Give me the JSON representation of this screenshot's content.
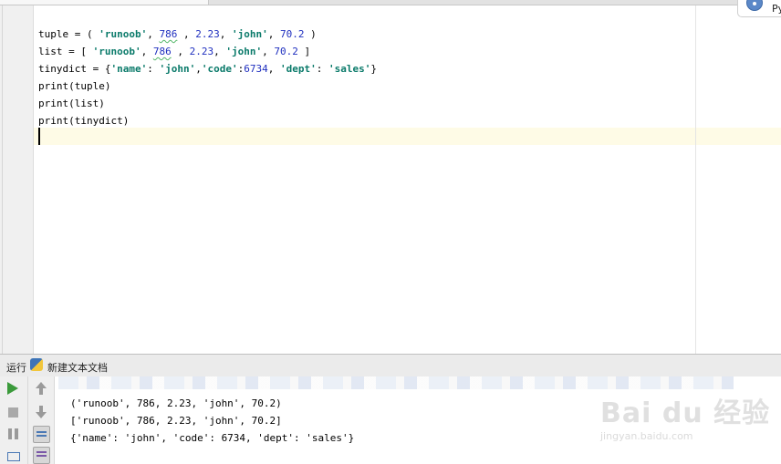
{
  "notification": {
    "text": "Py"
  },
  "editor": {
    "lines": [
      [
        {
          "t": "tuple = ( "
        },
        {
          "t": "'runoob'",
          "c": "str"
        },
        {
          "t": ", "
        },
        {
          "t": "786",
          "c": "num squig"
        },
        {
          "t": " , "
        },
        {
          "t": "2.23",
          "c": "num"
        },
        {
          "t": ", "
        },
        {
          "t": "'john'",
          "c": "str"
        },
        {
          "t": ", "
        },
        {
          "t": "70.2",
          "c": "num"
        },
        {
          "t": " )"
        }
      ],
      [
        {
          "t": "list = [ "
        },
        {
          "t": "'runoob'",
          "c": "str"
        },
        {
          "t": ", "
        },
        {
          "t": "786",
          "c": "num squig"
        },
        {
          "t": " , "
        },
        {
          "t": "2.23",
          "c": "num"
        },
        {
          "t": ", "
        },
        {
          "t": "'john'",
          "c": "str"
        },
        {
          "t": ", "
        },
        {
          "t": "70.2",
          "c": "num"
        },
        {
          "t": " ]"
        }
      ],
      [
        {
          "t": "tinydict = {"
        },
        {
          "t": "'name'",
          "c": "str"
        },
        {
          "t": ": "
        },
        {
          "t": "'john'",
          "c": "str"
        },
        {
          "t": ","
        },
        {
          "t": "'code'",
          "c": "str"
        },
        {
          "t": ":"
        },
        {
          "t": "6734",
          "c": "num"
        },
        {
          "t": ", "
        },
        {
          "t": "'dept'",
          "c": "str"
        },
        {
          "t": ": "
        },
        {
          "t": "'sales'",
          "c": "str"
        },
        {
          "t": "}"
        }
      ],
      [
        {
          "t": "print(tuple)"
        }
      ],
      [
        {
          "t": "print(list)"
        }
      ],
      [
        {
          "t": "print(tinydict)"
        }
      ]
    ]
  },
  "run_panel": {
    "label": "运行",
    "config_name": "新建文本文档",
    "output": [
      "('runoob', 786, 2.23, 'john', 70.2)",
      "['runoob', 786, 2.23, 'john', 70.2]",
      "{'name': 'john', 'code': 6734, 'dept': 'sales'}"
    ]
  },
  "watermark": {
    "brand": "Bai du 经验",
    "url": "jingyan.baidu.com"
  }
}
